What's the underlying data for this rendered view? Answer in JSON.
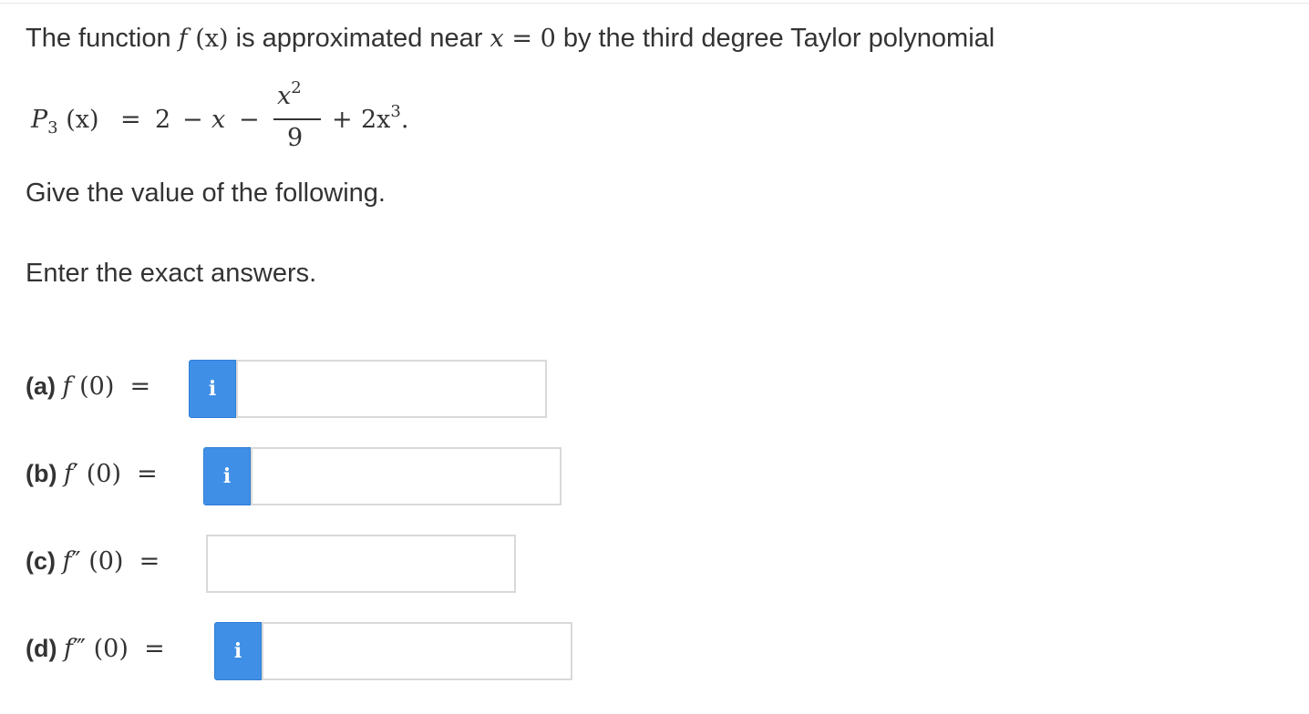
{
  "question": {
    "intro_before": "The function",
    "intro_f": "f",
    "intro_x": "(x)",
    "intro_middle": "is approximated near",
    "intro_var": "x",
    "intro_eq": "=",
    "intro_zero": "0",
    "intro_after": "by the third degree Taylor polynomial",
    "polynomial": {
      "lhs_P": "P",
      "lhs_sub": "3",
      "lhs_arg": "(x)",
      "equals": "=",
      "const": "2",
      "minus1": "−",
      "x": "x",
      "minus2": "−",
      "frac_num": "x",
      "frac_num_exp": "2",
      "frac_den": "9",
      "plus": "+",
      "coef": "2x",
      "cube_exp": "3",
      "period": "."
    },
    "instruction": "Give the value of the following.",
    "exact_note": "Enter the exact answers."
  },
  "answers": [
    {
      "label": "(a)",
      "expr_f": "f",
      "prime": "",
      "arg": "(0)",
      "eq": "=",
      "info": "i",
      "value": "",
      "has_info": true
    },
    {
      "label": "(b)",
      "expr_f": "f",
      "prime": "′",
      "arg": "(0)",
      "eq": "=",
      "info": "i",
      "value": "",
      "has_info": true
    },
    {
      "label": "(c)",
      "expr_f": "f",
      "prime": "″",
      "arg": "(0)",
      "eq": "=",
      "info": "",
      "value": "",
      "has_info": false
    },
    {
      "label": "(d)",
      "expr_f": "f",
      "prime": "‴",
      "arg": "(0)",
      "eq": "=",
      "info": "i",
      "value": "",
      "has_info": true
    }
  ],
  "colors": {
    "info_button": "#3f8fe6",
    "input_border": "#d9d9d9",
    "text": "#333333"
  },
  "icons": {
    "info": "info-icon"
  }
}
